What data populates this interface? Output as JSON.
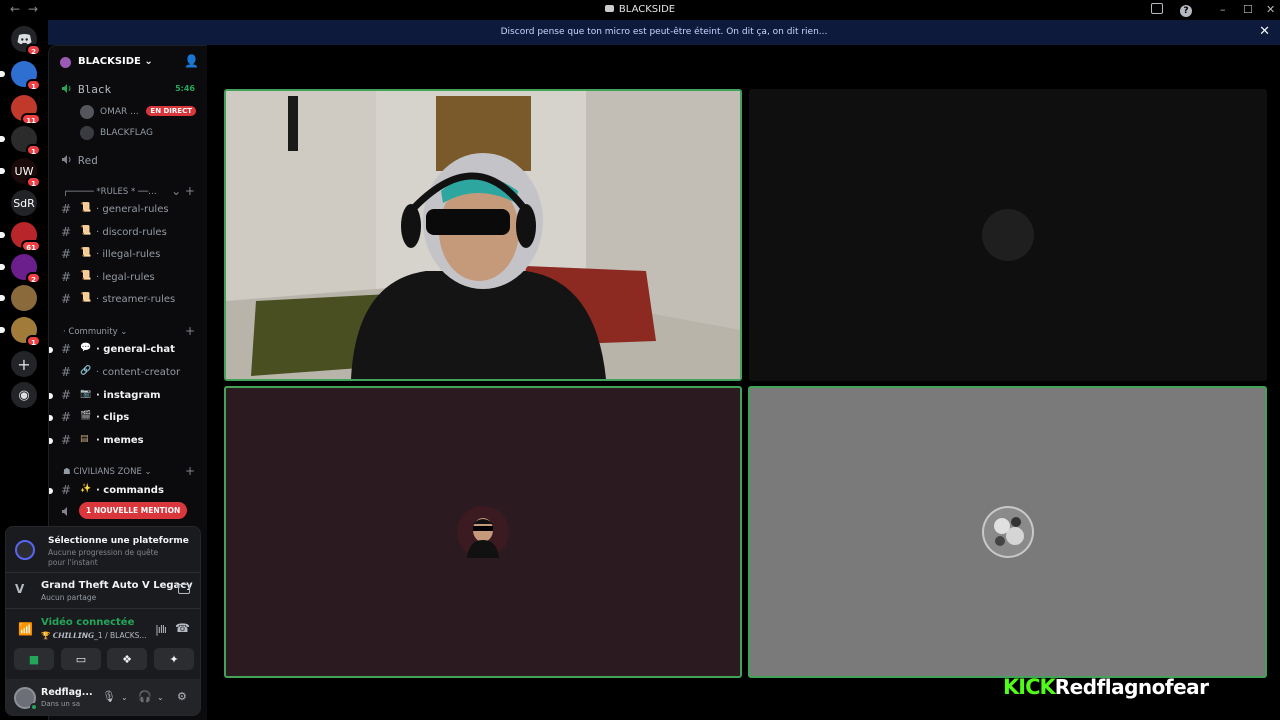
{
  "window": {
    "title": "BLACKSIDE",
    "back": "←",
    "forward": "→",
    "minimize": "–",
    "maximize": "☐",
    "close": "✕"
  },
  "notice": {
    "text": "Discord pense que ton micro est peut-être éteint. On dit ça, on dit rien...",
    "close": "✕"
  },
  "rail": {
    "home_badge": "2",
    "servers": [
      {
        "label": "",
        "badge": "1",
        "color": "#2f6fd1"
      },
      {
        "label": "",
        "badge": "11",
        "color": "#c0392b"
      },
      {
        "label": "",
        "badge": "1",
        "color": "#2b2b2b"
      },
      {
        "label": "UW",
        "badge": "1",
        "color": "#1a0a0a"
      },
      {
        "label": "SdR",
        "badge": "",
        "color": "#232428"
      },
      {
        "label": "",
        "badge": "61",
        "color": "#b8262c"
      },
      {
        "label": "",
        "badge": "2",
        "color": "#6a1f8c"
      },
      {
        "label": "",
        "badge": "",
        "color": "#8a6a3a"
      },
      {
        "label": "",
        "badge": "1",
        "color": "#a07b3a"
      }
    ],
    "add_icon": "+",
    "discover_icon": "◉"
  },
  "sidebar": {
    "guild_name": "BLACKSIDE",
    "voice1": {
      "name": "Black",
      "time": "5:46"
    },
    "members": [
      {
        "name": "OMAR ...",
        "live": "EN DIRECT"
      },
      {
        "name": "BLACKFLAG",
        "live": ""
      }
    ],
    "voice2": {
      "name": "Red"
    },
    "cat_rules": "┌───── *RULES * ──…",
    "rules_channels": [
      "general-rules",
      "discord-rules",
      "illegal-rules",
      "legal-rules",
      "streamer-rules"
    ],
    "cat_community": "· Community",
    "community_channels": [
      {
        "name": "general-chat",
        "emoji": "💬",
        "bright": true
      },
      {
        "name": "content-creator",
        "emoji": "🔗",
        "bright": false
      },
      {
        "name": "instagram",
        "emoji": "📷",
        "bright": true
      },
      {
        "name": "clips",
        "emoji": "🎬",
        "bright": true
      },
      {
        "name": "memes",
        "emoji": "▤",
        "bright": true
      }
    ],
    "cat_civilians": "CIVILIANS ZONE",
    "commands_channel": {
      "name": "commands",
      "emoji": "✨"
    },
    "mention": "1 NOUVELLE MENTION"
  },
  "panel": {
    "quest_title": "Sélectionne une plateforme",
    "quest_sub": "Aucune progression de quête pour l'instant",
    "game_title": "Grand Theft Auto V Legacy",
    "game_sub": "Aucun partage",
    "voice_status": "Vidéo connectée",
    "voice_channel": "🏆 𝘾𝙃𝙄𝙇𝙇𝙄𝙉𝙂_1 / BLACKS...",
    "user_name": "Redflag...",
    "user_status": "Dans un sa"
  },
  "stream": {
    "kick_logo": "KICK",
    "kick_name": "Redflagnofear"
  }
}
